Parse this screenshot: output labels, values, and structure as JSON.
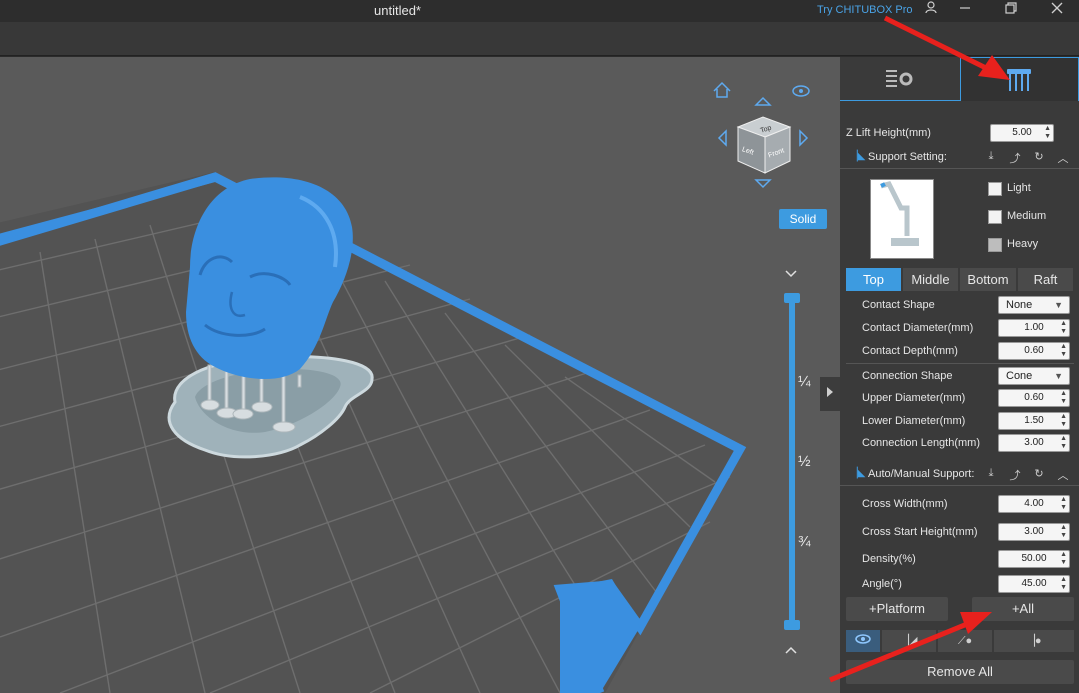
{
  "window": {
    "title": "untitled*",
    "try_link": "Try CHITUBOX Pro",
    "account_icon": "user-icon",
    "minimize_icon": "minimize-icon",
    "restore_icon": "restore-icon",
    "close_icon": "close-icon"
  },
  "viewport": {
    "view_mode": "Solid",
    "cube_faces": [
      "Top",
      "Left",
      "Front"
    ],
    "slider_fractions": [
      "¼",
      "½",
      "¾"
    ]
  },
  "panel": {
    "tabs": [
      {
        "name": "settings",
        "icon": "list-gear-icon"
      },
      {
        "name": "support",
        "icon": "support-table-icon"
      }
    ],
    "z_lift": {
      "label": "Z Lift Height(mm)",
      "value": "5.00"
    },
    "support_setting": {
      "label": "Support Setting:",
      "density_options": [
        "Light",
        "Medium",
        "Heavy"
      ],
      "selected_density": "Heavy"
    },
    "segments": [
      "Top",
      "Middle",
      "Bottom",
      "Raft"
    ],
    "active_segment": "Top",
    "top_fields": [
      {
        "label": "Contact Shape",
        "value": "None",
        "type": "select"
      },
      {
        "label": "Contact Diameter(mm)",
        "value": "1.00",
        "type": "spin"
      },
      {
        "label": "Contact Depth(mm)",
        "value": "0.60",
        "type": "spin"
      },
      {
        "label": "Connection Shape",
        "value": "Cone",
        "type": "select"
      },
      {
        "label": "Upper Diameter(mm)",
        "value": "0.60",
        "type": "spin"
      },
      {
        "label": "Lower Diameter(mm)",
        "value": "1.50",
        "type": "spin"
      },
      {
        "label": "Connection Length(mm)",
        "value": "3.00",
        "type": "spin"
      }
    ],
    "auto_manual": {
      "label": "Auto/Manual Support:"
    },
    "auto_fields": [
      {
        "label": "Cross Width(mm)",
        "value": "4.00"
      },
      {
        "label": "Cross Start Height(mm)",
        "value": "3.00"
      },
      {
        "label": "Density(%)",
        "value": "50.00"
      },
      {
        "label": "Angle(°)",
        "value": "45.00"
      }
    ],
    "platform_btn": "+Platform",
    "all_btn": "+All",
    "remove_all_btn": "Remove All"
  },
  "colors": {
    "accent": "#3d9be0",
    "model": "#3a8fe0",
    "arrow": "#e8211d"
  }
}
